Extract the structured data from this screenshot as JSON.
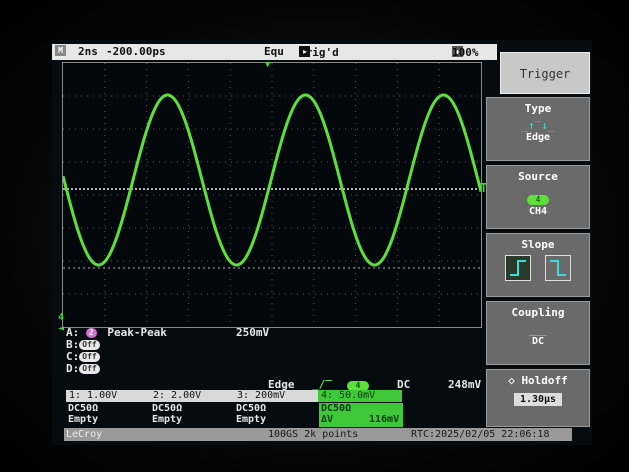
{
  "top": {
    "menu_icon": "M",
    "timebase": "2ns",
    "delay": "-200.00ps",
    "acq_mode": "Equ",
    "run_icon": "play-icon",
    "trigger_state": "Trig'd",
    "zoom_pct": "100%"
  },
  "waveform": {
    "trace_color": "#5ee03a",
    "ground_marker": "4",
    "trigger_level_marker": "T"
  },
  "measurements": [
    {
      "slot": "A:",
      "badge": "2",
      "active": true,
      "name": "Peak-Peak",
      "value": "250mV"
    },
    {
      "slot": "B:",
      "badge": "Off",
      "active": false,
      "name": "",
      "value": ""
    },
    {
      "slot": "C:",
      "badge": "Off",
      "active": false,
      "name": "",
      "value": ""
    },
    {
      "slot": "D:",
      "badge": "Off",
      "active": false,
      "name": "",
      "value": ""
    }
  ],
  "trigger_summary": {
    "type": "Edge",
    "source_badge": "4",
    "coupling": "DC",
    "level": "248mV"
  },
  "channels": [
    {
      "scale": "1: 1.00V",
      "coupling": "DC50Ω",
      "state": "Empty",
      "extra": ""
    },
    {
      "scale": "2: 2.00V",
      "coupling": "DC50Ω",
      "state": "Empty",
      "extra": ""
    },
    {
      "scale": "3: 200mV",
      "coupling": "DC50Ω",
      "state": "Empty",
      "extra": ""
    },
    {
      "scale": "4: 50.0mV",
      "coupling": "DC50Ω",
      "state": "ΔV",
      "extra": "116mV"
    }
  ],
  "bottom": {
    "brand": "LeCroy",
    "sample_info": "100GS 2k points",
    "rtc": "RTC:2025/02/05 22:06:18"
  },
  "menu": {
    "title": "Trigger",
    "type_label": "Type",
    "type_value": "Edge",
    "source_label": "Source",
    "source_badge": "4",
    "source_value": "CH4",
    "slope_label": "Slope",
    "coupling_label": "Coupling",
    "coupling_value": "DC",
    "holdoff_label": "Holdoff",
    "holdoff_value": "1.30μs"
  }
}
